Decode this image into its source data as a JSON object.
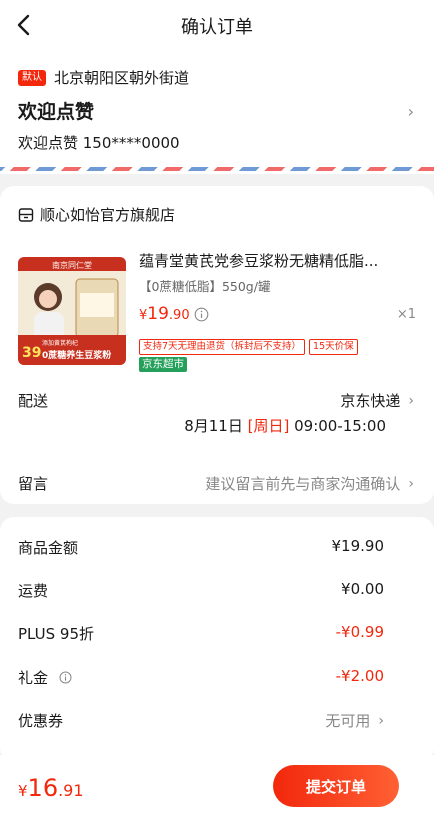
{
  "header": {
    "title": "确认订单"
  },
  "address": {
    "tag": "默认",
    "region": "北京朝阳区朝外街道",
    "name": "欢迎点赞",
    "contact": "欢迎点赞 150****0000"
  },
  "store": {
    "name": "顺心如怡官方旗舰店"
  },
  "product": {
    "title": "蕴青堂黄芪党参豆浆粉无糖精低脂...",
    "spec": "【0蔗糖低脂】550g/罐",
    "price_currency": "¥",
    "price_int": "19",
    "price_dec": ".90",
    "qty": "×1",
    "badges": [
      "支持7天无理由退货（拆封后不支持）",
      "15天价保"
    ],
    "jd_tag": "京东超市",
    "image": {
      "brand_text": "南京同仁堂",
      "promo_price": "39",
      "promo_text": "0蔗糖养生豆浆粉",
      "sub_text": "添加黄芪枸杞"
    }
  },
  "delivery": {
    "label": "配送",
    "method": "京东快递",
    "date": "8月11日",
    "weekday": "[周日]",
    "time": "09:00-15:00"
  },
  "message": {
    "label": "留言",
    "hint": "建议留言前先与商家沟通确认"
  },
  "summary": {
    "rows": [
      {
        "label": "商品金额",
        "value": "¥19.90"
      },
      {
        "label": "运费",
        "value": "¥0.00"
      },
      {
        "label": "PLUS 95折",
        "value": "-¥0.99"
      },
      {
        "label": "礼金",
        "value": "-¥2.00"
      },
      {
        "label": "优惠券",
        "value": "无可用"
      }
    ]
  },
  "footer": {
    "total_currency": "¥",
    "total_int": "16",
    "total_dec": ".91",
    "submit_label": "提交订单"
  },
  "colors": {
    "accent": "#f2270c",
    "jd_green": "#24a05a"
  }
}
